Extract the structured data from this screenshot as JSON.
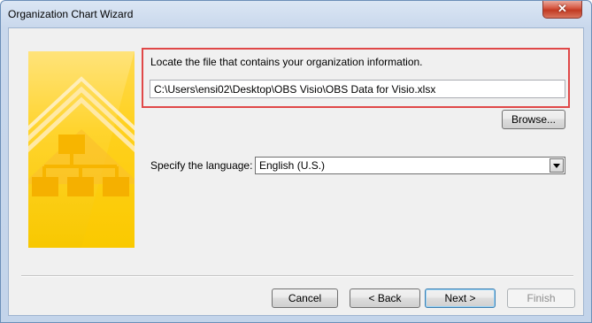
{
  "window": {
    "title": "Organization Chart Wizard"
  },
  "titlebar": {
    "close_glyph": "✕"
  },
  "main": {
    "instruction": "Locate the file that contains your organization information.",
    "file_path": "C:\\Users\\ensi02\\Desktop\\OBS Visio\\OBS Data for Visio.xlsx",
    "browse_label": "Browse...",
    "language_label": "Specify the language:",
    "language_value": "English (U.S.)"
  },
  "footer": {
    "cancel_label": "Cancel",
    "back_label": "< Back",
    "next_label": "Next >",
    "finish_label": "Finish"
  },
  "colors": {
    "highlight_border": "#e04848",
    "banner_yellow": "#ffd42e",
    "close_red": "#c13a22"
  },
  "icons": {
    "banner": "org-chart-icon",
    "dropdown": "chevron-down-icon"
  }
}
